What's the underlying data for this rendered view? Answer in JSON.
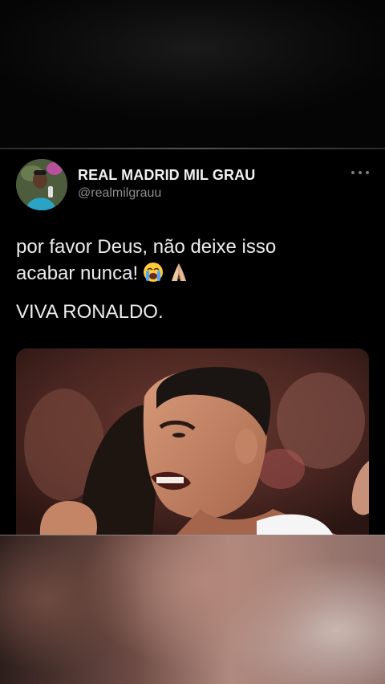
{
  "tweet": {
    "display_name": "REAL MADRID MIL GRAU",
    "handle": "@realmilgrauu",
    "text_line_1": "por favor Deus, não deixe isso",
    "text_line_2": "acabar nunca!",
    "text_line_3": "VIVA RONALDO.",
    "emojis": [
      "loudly-crying-face",
      "folded-hands"
    ]
  },
  "icons": {
    "more": "more-horizontal-icon"
  }
}
